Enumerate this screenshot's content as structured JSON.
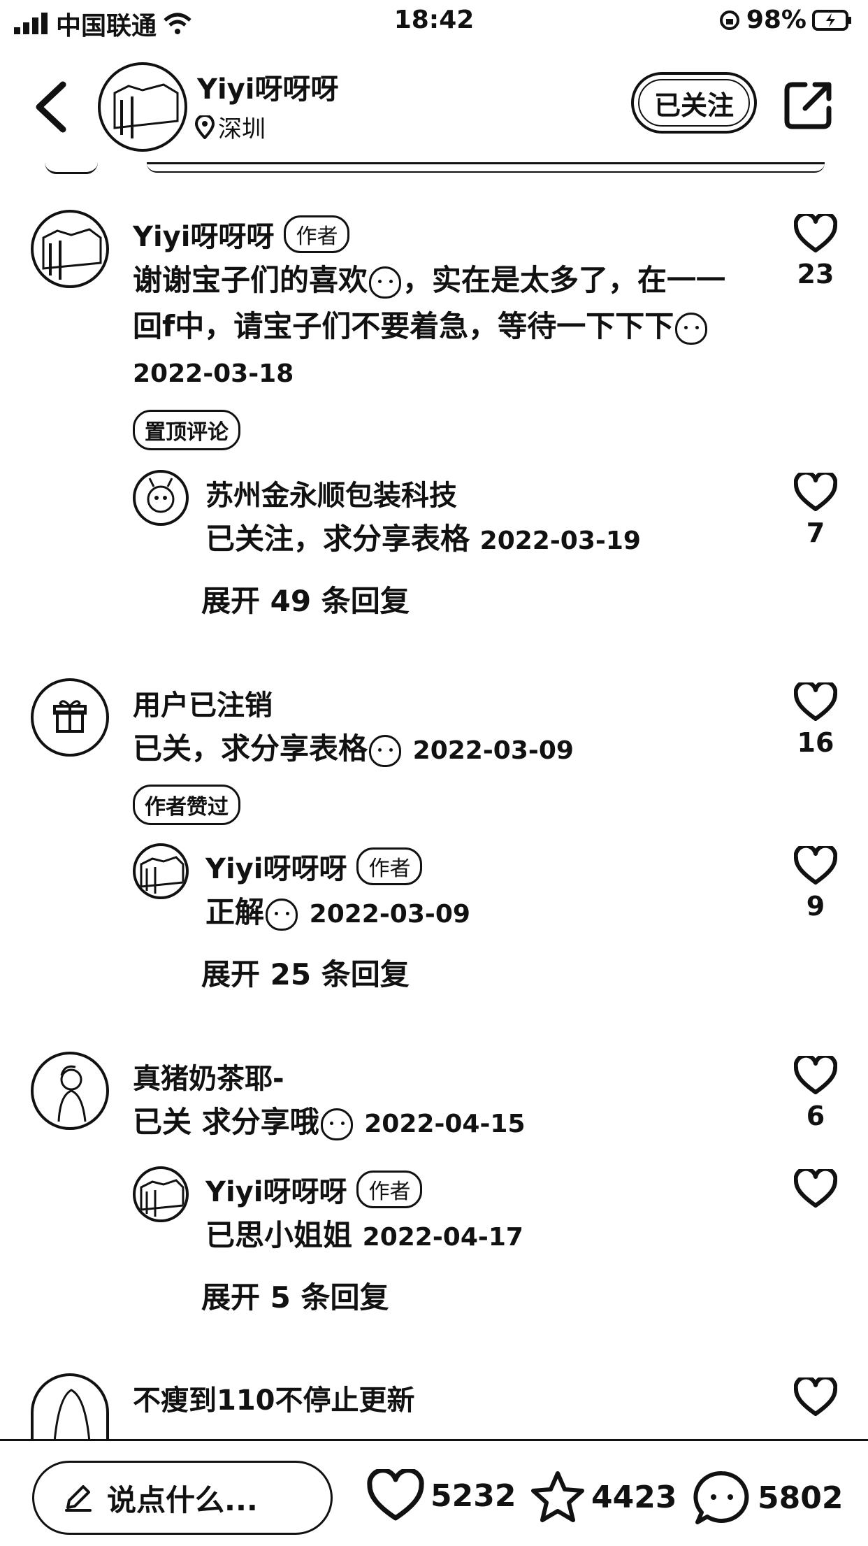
{
  "status_bar": {
    "carrier": "中国联通",
    "time": "18:42",
    "battery": "98%"
  },
  "header": {
    "author": "Yiyi呀呀呀",
    "location": "深圳",
    "follow_label": "已关注"
  },
  "comments": [
    {
      "name": "Yiyi呀呀呀",
      "tag": "作者",
      "text_line1": "谢谢宝子们的喜欢",
      "text_line1b": "，实在是太多了，在一一",
      "text_line2": "回f中，请宝子们不要着急，等待一下下下",
      "date": "2022-03-18",
      "pill": "置顶评论",
      "likes": "23",
      "reply": {
        "name": "苏州金永顺包装科技",
        "text": "已关注，求分享表格",
        "date": "2022-03-19",
        "likes": "7"
      },
      "expand": "展开 49 条回复"
    },
    {
      "name": "用户已注销",
      "text": "已关，求分享表格",
      "date": "2022-03-09",
      "pill": "作者赞过",
      "likes": "16",
      "reply": {
        "name": "Yiyi呀呀呀",
        "tag": "作者",
        "text": "正解",
        "date": "2022-03-09",
        "likes": "9"
      },
      "expand": "展开 25 条回复"
    },
    {
      "name": "真猪奶茶耶-",
      "text": "已关 求分享哦",
      "date": "2022-04-15",
      "likes": "6",
      "reply": {
        "name": "Yiyi呀呀呀",
        "tag": "作者",
        "text": "已思小姐姐",
        "date": "2022-04-17"
      },
      "expand": "展开 5 条回复"
    },
    {
      "name": "不瘦到110不停止更新"
    }
  ],
  "bottom_bar": {
    "placeholder": "说点什么...",
    "likes": "5232",
    "stars": "4423",
    "comments": "5802"
  },
  "icons": [
    "signal-icon",
    "wifi-icon",
    "lock-icon",
    "battery-icon",
    "back-icon",
    "location-icon",
    "share-icon",
    "heart-icon",
    "gift-icon",
    "pencil-icon",
    "star-icon",
    "chat-icon"
  ]
}
